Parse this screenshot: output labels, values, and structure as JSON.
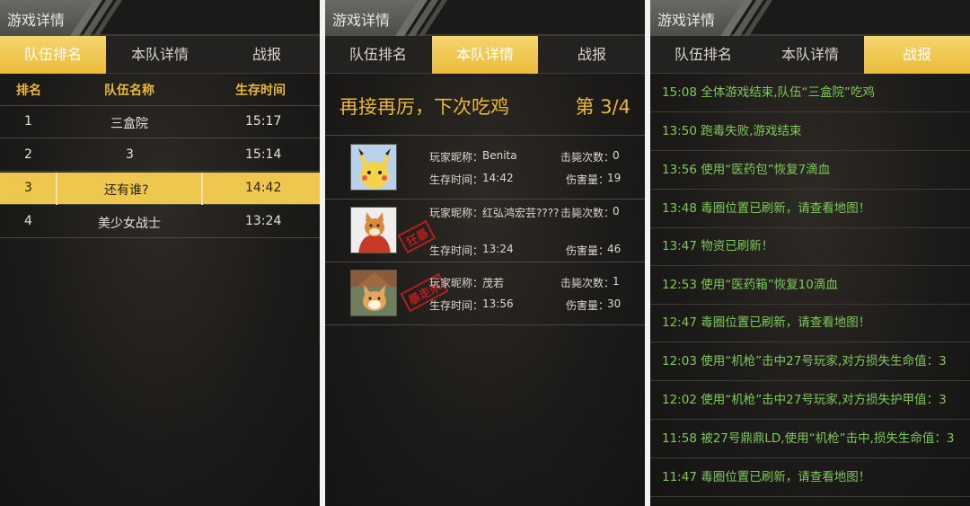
{
  "panel_ranking": {
    "header_title": "游戏详情",
    "tabs": [
      "队伍排名",
      "本队详情",
      "战报"
    ],
    "active_tab": 0,
    "columns": [
      "排名",
      "队伍名称",
      "生存时间"
    ],
    "rows": [
      {
        "rank": "1",
        "team": "三盒院",
        "time": "15:17"
      },
      {
        "rank": "2",
        "team": "3",
        "time": "15:14"
      },
      {
        "rank": "3",
        "team": "还有谁?",
        "time": "14:42"
      },
      {
        "rank": "4",
        "team": "美少女战士",
        "time": "13:24"
      }
    ]
  },
  "panel_team": {
    "header_title": "游戏详情",
    "tabs": [
      "队伍排名",
      "本队详情",
      "战报"
    ],
    "active_tab": 1,
    "slogan": "再接再厉，下次吃鸡",
    "placement": "第 3/4",
    "players": [
      {
        "nick_label": "玩家昵称：",
        "nick": "Benita",
        "kills_label": "击毙次数：",
        "kills": "0",
        "survive_label": "生存时间：",
        "survive": "14:42",
        "damage_label": "伤害量：",
        "damage": "19",
        "stamp": "",
        "avatar_icon": "pikachu-avatar-icon"
      },
      {
        "nick_label": "玩家昵称：",
        "nick": "红弘鸿宏芸????",
        "kills_label": "击毙次数：",
        "kills": "0",
        "survive_label": "生存时间：",
        "survive": "13:24",
        "damage_label": "伤害量：",
        "damage": "46",
        "stamp": "狂暴",
        "avatar_icon": "shiba-dog-avatar-icon"
      },
      {
        "nick_label": "玩家昵称：",
        "nick": "茂若",
        "kills_label": "击毙次数：",
        "kills": "1",
        "survive_label": "生存时间：",
        "survive": "13:56",
        "damage_label": "伤害量：",
        "damage": "30",
        "stamp": "暴走杀",
        "avatar_icon": "corgi-dog-avatar-icon"
      }
    ]
  },
  "panel_log": {
    "header_title": "游戏详情",
    "tabs": [
      "队伍排名",
      "本队详情",
      "战报"
    ],
    "active_tab": 2,
    "entries": [
      "15:08 全体游戏结束,队伍“三盒院”吃鸡",
      "13:50 跑毒失败,游戏结束",
      "13:56 使用“医药包”恢复7滴血",
      "13:48 毒圈位置已刷新，请查看地图！",
      "13:47 物资已刷新！",
      "12:53 使用“医药箱”恢复10滴血",
      "12:47 毒圈位置已刷新，请查看地图！",
      "12:03 使用“机枪”击中27号玩家,对方损失生命值：3",
      "12:02 使用“机枪”击中27号玩家,对方损失护甲值：3",
      "11:58 被27号鼎鼎LD,使用“机枪”击中,损失生命值：3",
      "11:47 毒圈位置已刷新，请查看地图！"
    ]
  },
  "colors": {
    "accent": "#e9b73a",
    "active_tab": "#eec74f",
    "log_text": "#7ec85a",
    "stamp": "#c41e1e"
  }
}
